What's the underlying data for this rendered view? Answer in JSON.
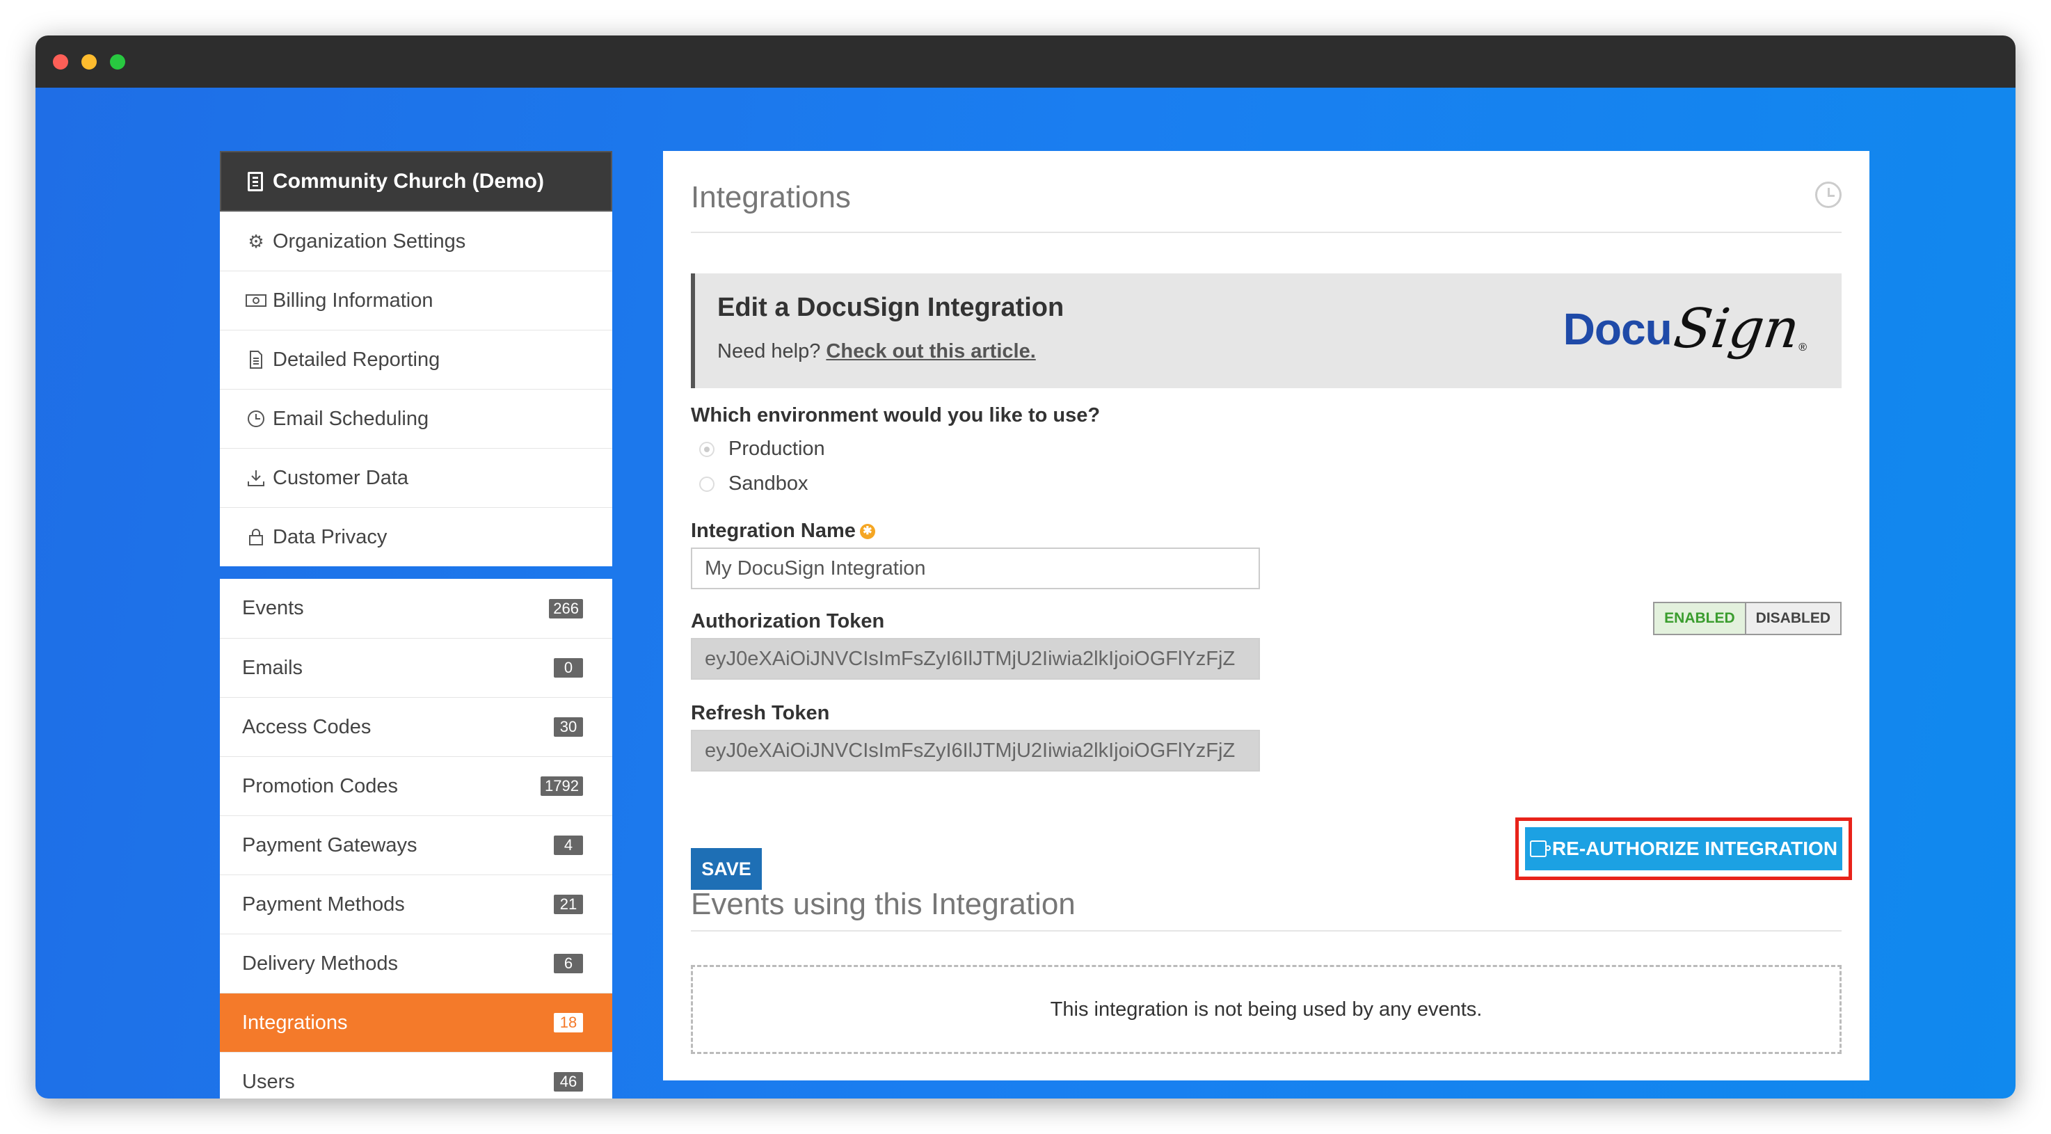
{
  "sidebar": {
    "org_name": "Community Church (Demo)",
    "settings": [
      {
        "label": "Organization Settings",
        "icon": "gear-icon"
      },
      {
        "label": "Billing Information",
        "icon": "money-icon"
      },
      {
        "label": "Detailed Reporting",
        "icon": "document-icon"
      },
      {
        "label": "Email Scheduling",
        "icon": "clock-icon"
      },
      {
        "label": "Customer Data",
        "icon": "download-icon"
      },
      {
        "label": "Data Privacy",
        "icon": "lock-icon"
      }
    ],
    "nav": [
      {
        "label": "Events",
        "count": "266"
      },
      {
        "label": "Emails",
        "count": "0"
      },
      {
        "label": "Access Codes",
        "count": "30"
      },
      {
        "label": "Promotion Codes",
        "count": "1792"
      },
      {
        "label": "Payment Gateways",
        "count": "4"
      },
      {
        "label": "Payment Methods",
        "count": "21"
      },
      {
        "label": "Delivery Methods",
        "count": "6"
      },
      {
        "label": "Integrations",
        "count": "18",
        "active": true
      },
      {
        "label": "Users",
        "count": "46"
      }
    ]
  },
  "main": {
    "title": "Integrations",
    "banner": {
      "heading": "Edit a DocuSign Integration",
      "help_prefix": "Need help?",
      "help_link": "Check out this article.",
      "logo_left": "Docu",
      "logo_right": "Sign",
      "logo_reg": "®"
    },
    "environment": {
      "question": "Which environment would you like to use?",
      "options": [
        "Production",
        "Sandbox"
      ],
      "selected": "Production"
    },
    "integration_name": {
      "label": "Integration Name",
      "value": "My DocuSign Integration"
    },
    "toggle": {
      "enabled": "ENABLED",
      "disabled": "DISABLED",
      "state": "enabled"
    },
    "auth_token": {
      "label": "Authorization Token",
      "value": "eyJ0eXAiOiJNVCIsImFsZyI6IlJTMjU2Iiwia2lkIjoiOGFlYzFjZ"
    },
    "refresh_token": {
      "label": "Refresh Token",
      "value": "eyJ0eXAiOiJNVCIsImFsZyI6IlJTMjU2Iiwia2lkIjoiOGFlYzFjZ"
    },
    "save_label": "SAVE",
    "reauth_label": "RE-AUTHORIZE INTEGRATION",
    "events_title": "Events using this Integration",
    "events_empty": "This integration is not being used by any events."
  },
  "colors": {
    "accent_orange": "#f47a2a",
    "save_blue": "#1e6fb5",
    "reauth_blue": "#1ca1e3",
    "highlight_red": "#e8231a",
    "docusign_blue": "#1f4aa8"
  }
}
